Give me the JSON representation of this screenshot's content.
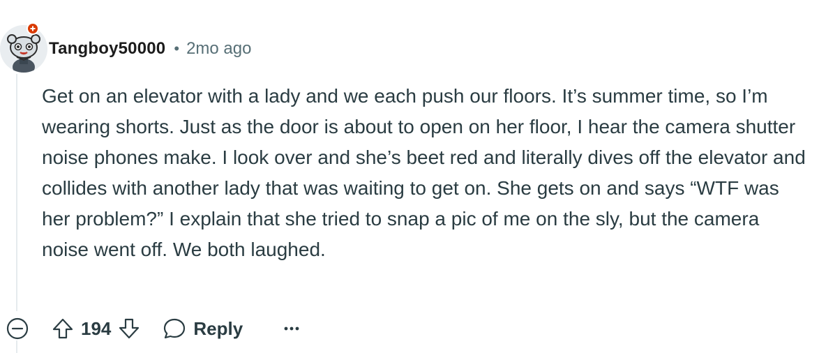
{
  "comment": {
    "author": "Tangboy50000",
    "separator": "•",
    "timestamp": "2mo ago",
    "body": "Get on an elevator with a lady and we each push our floors. It’s summer time, so I’m wearing shorts. Just as the door is about to open on her floor, I hear the camera shutter noise phones make. I look over and she’s beet red and literally dives off the elevator and collides with another lady that was waiting to get on. She gets on and says “WTF was her problem?” I explain that she tried to snap a pic of me on the sly, but the camera noise went off. We both laughed."
  },
  "actions": {
    "collapse_icon": "collapse-minus-icon",
    "upvote_icon": "upvote-arrow-icon",
    "score": "194",
    "downvote_icon": "downvote-arrow-icon",
    "reply_icon": "speech-bubble-icon",
    "reply_label": "Reply",
    "more_icon": "more-dots-icon"
  },
  "colors": {
    "text_primary": "#1c1c1c",
    "text_body": "#2a3c42",
    "text_meta": "#576f76",
    "thread_line": "#e5ebee",
    "badge_red": "#d93a00"
  }
}
